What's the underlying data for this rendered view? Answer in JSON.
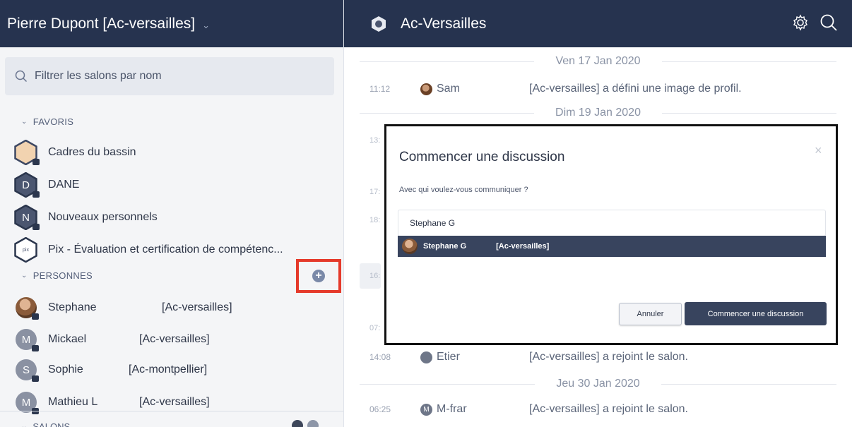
{
  "sidebar": {
    "user_name": "Pierre Dupont [Ac-versailles]",
    "filter_placeholder": "Filtrer les salons par nom",
    "favorites_label": "FAVORIS",
    "favorites": [
      {
        "name": "Cadres du bassin",
        "letter": "",
        "color": "#f2d3b0"
      },
      {
        "name": "DANE",
        "letter": "D",
        "color": "#4b5670"
      },
      {
        "name": "Nouveaux personnels",
        "letter": "N",
        "color": "#4b5670"
      },
      {
        "name": "Pix - Évaluation et certification de compétenc...",
        "letter": "pix",
        "color": "#ffffff"
      }
    ],
    "people_label": "PERSONNES",
    "people": [
      {
        "name": "Stephane",
        "domain": "[Ac-versailles]",
        "initial": ""
      },
      {
        "name": "Mickael",
        "domain": "[Ac-versailles]",
        "initial": "M"
      },
      {
        "name": "Sophie",
        "domain": "[Ac-montpellier]",
        "initial": "S"
      },
      {
        "name": "Mathieu L",
        "domain": "[Ac-versailles]",
        "initial": "M"
      }
    ],
    "salons_label": "SALONS"
  },
  "room": {
    "title": "Ac-Versailles",
    "dates": [
      "Ven 17 Jan 2020",
      "Dim 19 Jan 2020",
      "Jeu 30 Jan 2020"
    ],
    "messages": [
      {
        "time": "11:12",
        "sender": "Sam",
        "text": "[Ac-versailles] a défini une image de profil.",
        "initial": ""
      },
      {
        "time": "14:08",
        "sender": "Etier",
        "text": "[Ac-versailles] a rejoint le salon.",
        "initial": ""
      },
      {
        "time": "06:25",
        "sender": "M-frar",
        "text": "[Ac-versailles] a rejoint le salon.",
        "initial": "M"
      }
    ],
    "partial_times": [
      "13:",
      "17:",
      "18:",
      "16:",
      "07:"
    ]
  },
  "dialog": {
    "title": "Commencer une discussion",
    "close": "×",
    "question": "Avec qui voulez-vous communiquer ?",
    "input_value": "Stephane G",
    "suggestion_name": "Stephane G",
    "suggestion_domain": "[Ac-versailles]",
    "cancel_label": "Annuler",
    "start_label": "Commencer une discussion"
  },
  "colors": {
    "header_bg": "#26334f",
    "highlight_box": "#e53a2b",
    "primary_button": "#38445e"
  },
  "icons": [
    "search-icon",
    "gear-icon",
    "chevron-down-icon",
    "plus-circle-icon",
    "room-avatar-icon",
    "lock-icon",
    "close-icon"
  ]
}
